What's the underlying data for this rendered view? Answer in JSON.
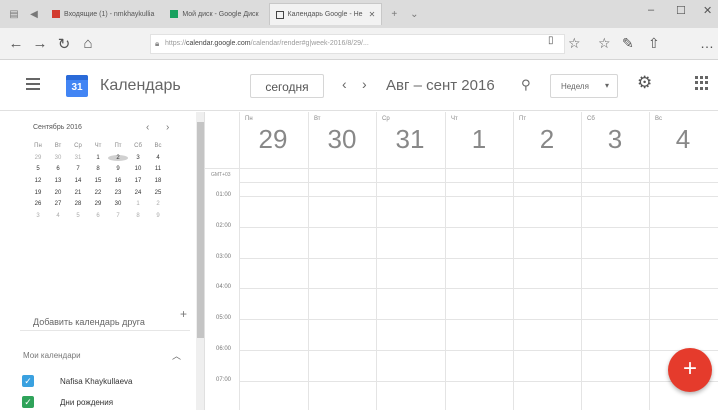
{
  "browser": {
    "tabs": [
      {
        "label": "Входящие (1) - nmkhaykullia",
        "active": false,
        "color": "#d23b2f"
      },
      {
        "label": "Мой диск - Google Диск",
        "active": false,
        "color": "#19a15f"
      },
      {
        "label": "Календарь Google - Не",
        "active": true,
        "color": "#4285f4"
      }
    ],
    "url_prefix": "https://",
    "url_host": "calendar.google.com",
    "url_path": "/calendar/render#g|week-2016/8/29/..."
  },
  "app": {
    "logo_text": "31",
    "name": "Календарь",
    "today_label": "сегодня",
    "range_label": "Авг – сент 2016",
    "view_label": "Неделя",
    "accent": "#4285f4"
  },
  "mini_calendar": {
    "title": "Сентябрь 2016",
    "weekday_headers": [
      "Пн",
      "Вт",
      "Ср",
      "Чт",
      "Пт",
      "Сб",
      "Вс"
    ],
    "rows": [
      [
        "29",
        "30",
        "31",
        "1",
        "2",
        "3",
        "4"
      ],
      [
        "5",
        "6",
        "7",
        "8",
        "9",
        "10",
        "11"
      ],
      [
        "12",
        "13",
        "14",
        "15",
        "16",
        "17",
        "18"
      ],
      [
        "19",
        "20",
        "21",
        "22",
        "23",
        "24",
        "25"
      ],
      [
        "26",
        "27",
        "28",
        "29",
        "30",
        "1",
        "2"
      ],
      [
        "3",
        "4",
        "5",
        "6",
        "7",
        "8",
        "9"
      ]
    ]
  },
  "sidebar": {
    "add_calendar_placeholder": "Добавить календарь друга",
    "my_calendars_title": "Мои календари",
    "calendars": [
      {
        "name": "Nafisa Khaykullaeva",
        "color": "#3aa1e0"
      },
      {
        "name": "Дни рождения",
        "color": "#2fa35a"
      }
    ]
  },
  "week": {
    "allday_label": "GMT+03",
    "days": [
      {
        "name": "Пн",
        "date": "29"
      },
      {
        "name": "Вт",
        "date": "30"
      },
      {
        "name": "Ср",
        "date": "31"
      },
      {
        "name": "Чт",
        "date": "1"
      },
      {
        "name": "Пт",
        "date": "2"
      },
      {
        "name": "Сб",
        "date": "3"
      },
      {
        "name": "Вс",
        "date": "4"
      }
    ],
    "time_labels": [
      "01:00",
      "02:00",
      "03:00",
      "04:00",
      "05:00",
      "06:00",
      "07:00"
    ]
  },
  "fab": {
    "label": "+",
    "color": "#e53b2c"
  }
}
